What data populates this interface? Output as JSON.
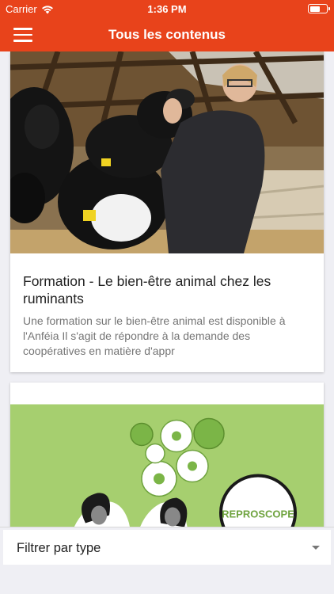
{
  "status_bar": {
    "carrier": "Carrier",
    "time": "1:36 PM"
  },
  "nav": {
    "title": "Tous les contenus"
  },
  "feed": {
    "items": [
      {
        "title": "Formation - Le bien-être animal chez les ruminants",
        "excerpt": "Une formation sur le bien-être animal est disponible à l'Anféia Il s'agit de répondre à la demande des coopératives en matière d'appr"
      },
      {
        "image_text": "REPROSCOPE"
      }
    ]
  },
  "filter": {
    "label": "Filtrer par type"
  },
  "colors": {
    "accent": "#e8431b",
    "card_bg": "#ffffff",
    "page_bg": "#efeff4"
  }
}
